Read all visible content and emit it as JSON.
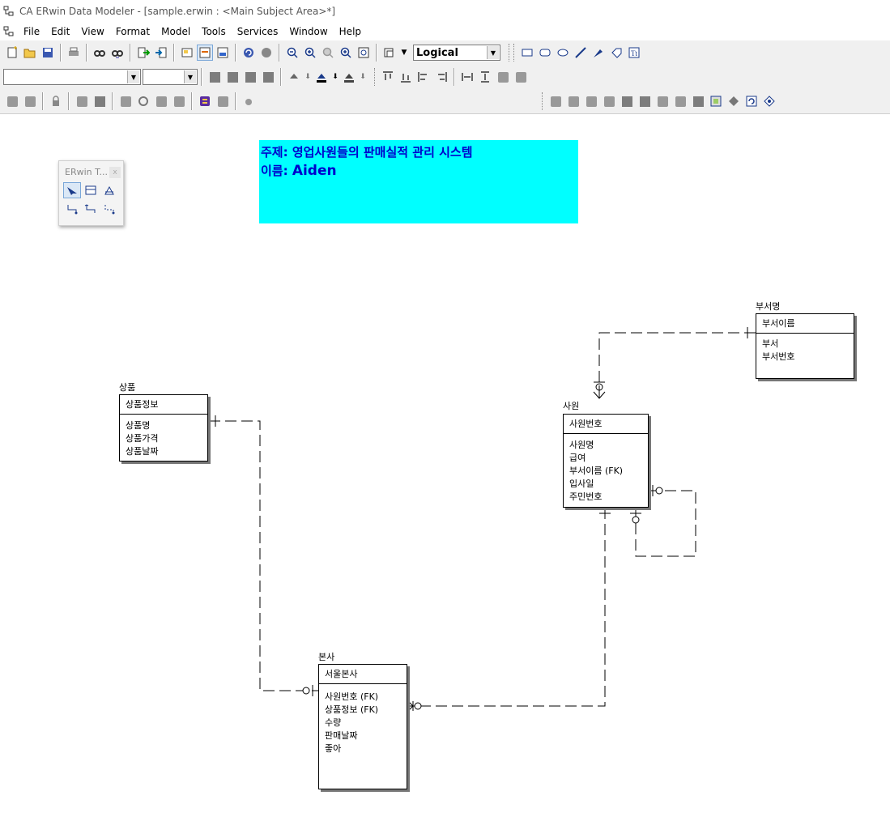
{
  "window": {
    "title": "CA ERwin Data Modeler - [sample.erwin : <Main Subject Area>*]"
  },
  "menu": [
    "File",
    "Edit",
    "View",
    "Format",
    "Model",
    "Tools",
    "Services",
    "Window",
    "Help"
  ],
  "toolbar": {
    "view_mode": "Logical"
  },
  "palette": {
    "title": "ERwin T...",
    "close": "x"
  },
  "note": {
    "line1": "주제: 영업사원들의 판매실적 관리 시스템",
    "line2_label": "이름: ",
    "line2_name": "Aiden"
  },
  "entities": {
    "dept": {
      "name": "부서명",
      "key": "부서이름",
      "attrs": [
        "부서",
        "부서번호"
      ]
    },
    "product": {
      "name": "상품",
      "key": "상품정보",
      "attrs": [
        "상품명",
        "상품가격",
        "상품날짜"
      ]
    },
    "employee": {
      "name": "사원",
      "key": "사원번호",
      "attrs": [
        "사원명",
        "급여",
        "부서이름 (FK)",
        "입사일",
        "주민번호"
      ]
    },
    "hq": {
      "name": "본사",
      "key": "서울본사",
      "attrs": [
        "사원번호 (FK)",
        "상품정보 (FK)",
        "수량",
        "판매날짜",
        "좋아"
      ]
    }
  },
  "colors": {
    "note_bg": "#00ffff",
    "note_text": "#0000cc",
    "toolbar_bg": "#f0f0f0"
  }
}
